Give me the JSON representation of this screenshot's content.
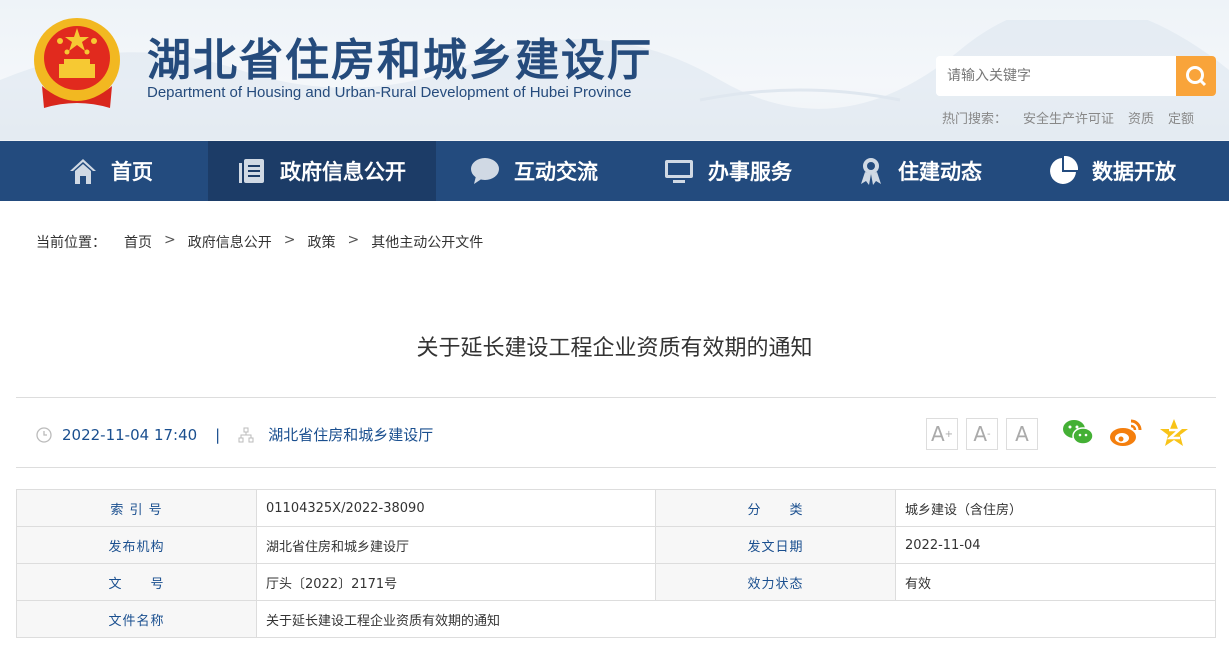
{
  "header": {
    "title_cn": "湖北省住房和城乡建设厅",
    "title_en": "Department of Housing and Urban-Rural Development of Hubei Province",
    "search_placeholder": "请输入关键字",
    "hot_label": "热门搜索：",
    "hot_items": [
      "安全生产许可证",
      "资质",
      "定额"
    ]
  },
  "nav": [
    {
      "label": "首页",
      "icon": "home-icon"
    },
    {
      "label": "政府信息公开",
      "icon": "document-icon",
      "active": true
    },
    {
      "label": "互动交流",
      "icon": "chat-bubble-icon"
    },
    {
      "label": "办事服务",
      "icon": "monitor-icon"
    },
    {
      "label": "住建动态",
      "icon": "award-icon"
    },
    {
      "label": "数据开放",
      "icon": "pie-chart-icon"
    }
  ],
  "breadcrumb": {
    "label": "当前位置：",
    "items": [
      "首页",
      "政府信息公开",
      "政策",
      "其他主动公开文件"
    ],
    "sep": ">"
  },
  "article": {
    "title": "关于延长建设工程企业资质有效期的通知",
    "datetime": "2022-11-04 17:40",
    "divider": "|",
    "publisher": "湖北省住房和城乡建设厅"
  },
  "font_buttons": [
    "A",
    "A",
    "A"
  ],
  "table": {
    "rows": [
      [
        "索 引 号",
        "01104325X/2022-38090",
        "分　　类",
        "城乡建设（含住房）"
      ],
      [
        "发布机构",
        "湖北省住房和城乡建设厅",
        "发文日期",
        "2022-11-04"
      ],
      [
        "文　　号",
        "厅头〔2022〕2171号",
        "效力状态",
        "有效"
      ],
      [
        "文件名称",
        "关于延长建设工程企业资质有效期的通知"
      ]
    ]
  },
  "colors": {
    "nav": "#234b7e",
    "nav_active": "#1c3c67",
    "accent": "#f9a43a",
    "label": "#1a4f8f"
  }
}
